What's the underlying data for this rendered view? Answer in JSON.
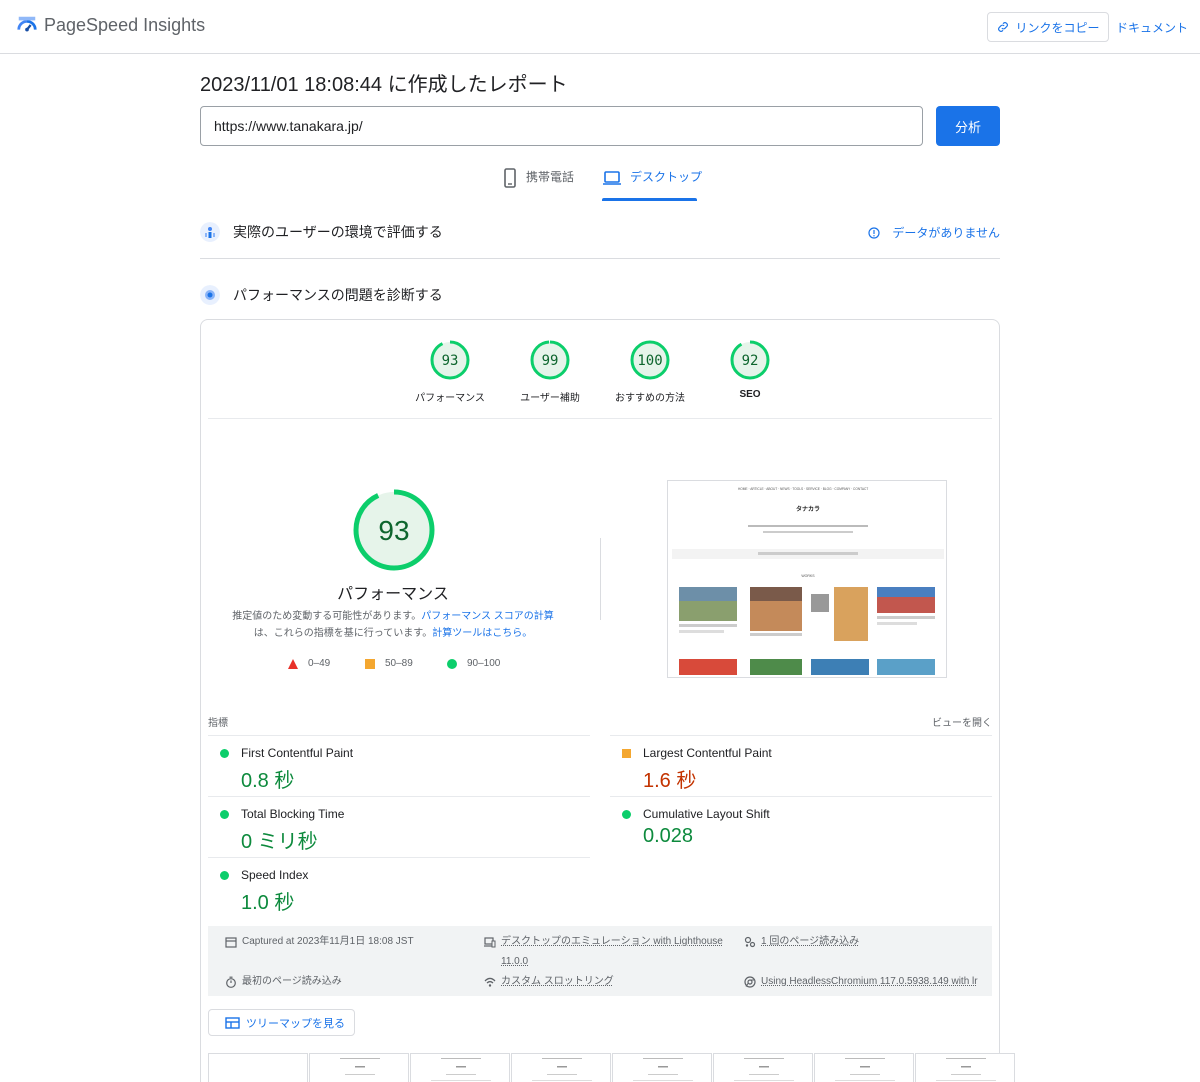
{
  "app": {
    "name": "PageSpeed Insights",
    "copy_link_label": "リンクをコピー",
    "docs_label": "ドキュメント"
  },
  "report": {
    "title": "2023/11/01 18:08:44 に作成したレポート",
    "url_value": "https://www.tanakara.jp/",
    "analyze_label": "分析"
  },
  "tabs": [
    {
      "label": "携帯電話",
      "icon": "phone-icon",
      "active": false
    },
    {
      "label": "デスクトップ",
      "icon": "laptop-icon",
      "active": true
    }
  ],
  "field_section": {
    "title": "実際のユーザーの環境で評価する",
    "status": "データがありません"
  },
  "lab_section": {
    "title": "パフォーマンスの問題を診断する"
  },
  "scores": [
    {
      "label": "パフォーマンス",
      "value": "93",
      "score": 0.93
    },
    {
      "label": "ユーザー補助",
      "value": "99",
      "score": 0.99
    },
    {
      "label": "おすすめの方法",
      "value": "100",
      "score": 1.0
    },
    {
      "label": "SEO",
      "value": "92",
      "score": 0.92
    }
  ],
  "performance": {
    "score": "93",
    "score_fraction": 0.93,
    "label": "パフォーマンス",
    "desc_prefix": "推定値のため変動する可能性があります。",
    "desc_link1": "パフォーマンス スコアの計算",
    "desc_middle": "は、これらの指標を基に行っています。",
    "desc_link2": "計算ツールはこちら。",
    "legend": [
      {
        "range": "0–49",
        "color": "#e8312a",
        "shape": "triangle"
      },
      {
        "range": "50–89",
        "color": "#f4a730",
        "shape": "square"
      },
      {
        "range": "90–100",
        "color": "#0cce6b",
        "shape": "circle"
      }
    ]
  },
  "thumbnail": {
    "site_title": "タナカラ",
    "nav": [
      "HOME",
      "ARTICLE",
      "ABOUT",
      "NEWS",
      "TOOLS",
      "SERVICE",
      "BLOG",
      "COMPANY",
      "CONTACT"
    ],
    "section_label": "WORKS"
  },
  "metrics": {
    "header": "指標",
    "expand": "ビューを開く",
    "items": [
      {
        "name": "First Contentful Paint",
        "value": "0.8 秒",
        "status": "good"
      },
      {
        "name": "Largest Contentful Paint",
        "value": "1.6 秒",
        "status": "average"
      },
      {
        "name": "Total Blocking Time",
        "value": "0 ミリ秒",
        "status": "good"
      },
      {
        "name": "Cumulative Layout Shift",
        "value": "0.028",
        "status": "good"
      },
      {
        "name": "Speed Index",
        "value": "1.0 秒",
        "status": "good"
      }
    ]
  },
  "runtime": {
    "captured": "Captured at 2023年11月1日 18:08 JST",
    "emulation_line1": "デスクトップのエミュレーション with Lighthouse",
    "emulation_line2": "11.0.0",
    "page_loads": "1 回のページ読み込み",
    "first_load": "最初のページ読み込み",
    "throttling": "カスタム スロットリング",
    "browser": "Using HeadlessChromium 117.0.5938.149 with lr"
  },
  "treemap_label": "ツリーマップを見る"
}
